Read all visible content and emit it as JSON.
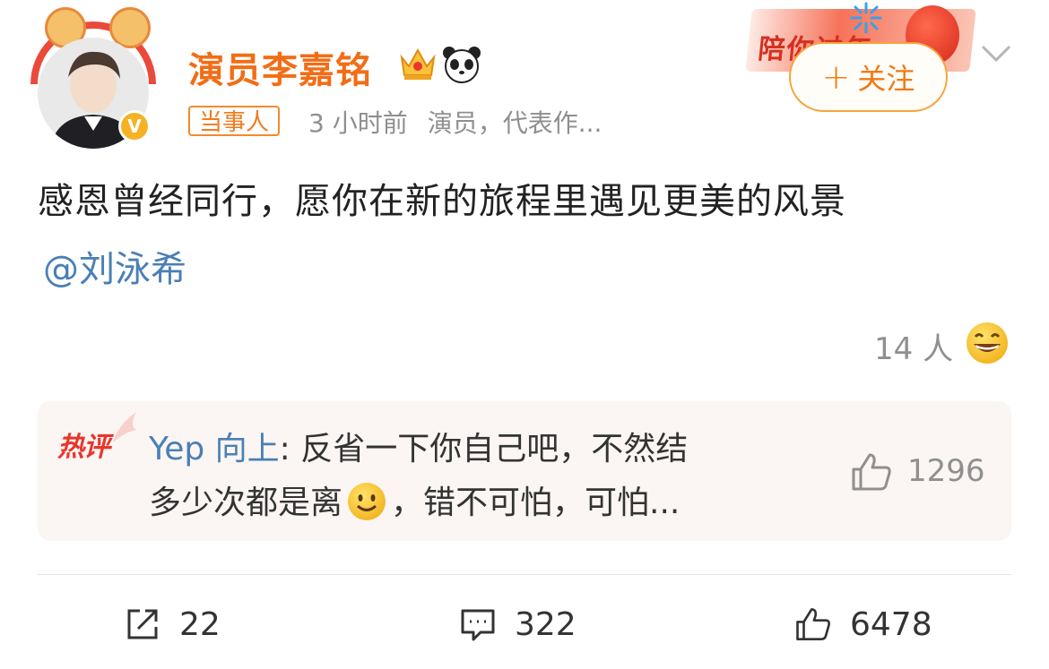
{
  "user": {
    "name": "演员李嘉铭",
    "badge": "当事人",
    "time": "3 小时前",
    "bio": "演员，代表作...",
    "verified_mark": "V"
  },
  "promo": {
    "text": "陪你过年"
  },
  "follow_button": {
    "plus": "+",
    "label": "关注"
  },
  "post": {
    "text": "感恩曾经同行，愿你在新的旅程里遇见更美的风景",
    "mention": "@刘泳希"
  },
  "reaction": {
    "count": "14 人",
    "icon": "grin-emoji"
  },
  "hot_comment": {
    "tag": "热评",
    "user": "Yep 向上",
    "text_line1": ": 反省一下你自己吧，不然结",
    "text_line2_before": "多少次都是离",
    "text_line2_after": "，错不可怕，可怕...",
    "like_count": "1296"
  },
  "actions": {
    "repost": "22",
    "comment": "322",
    "like": "6478"
  },
  "colors": {
    "accent_orange": "#f26d16",
    "link_blue": "#4a7fb5",
    "hot_red": "#e8362c"
  }
}
